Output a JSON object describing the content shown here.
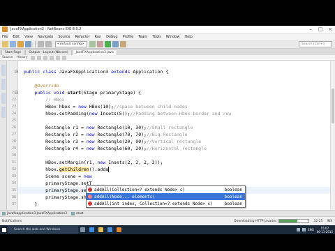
{
  "window": {
    "title": "JavaFXApplication3 - NetBeans IDE 8.0.2",
    "controls": [
      "–",
      "□",
      "×"
    ]
  },
  "menu": [
    "File",
    "Edit",
    "View",
    "Navigate",
    "Source",
    "Refactor",
    "Run",
    "Debug",
    "Profile",
    "Team",
    "Tools",
    "Window",
    "Help"
  ],
  "toolbar": {
    "config": "<default config>",
    "search_placeholder": "Search (Ctrl+I)"
  },
  "tabs": [
    {
      "label": "Start Page",
      "active": false
    },
    {
      "label": "Output - Layout (Nbcore)",
      "active": false
    },
    {
      "label": "JavaFXApplication3.java",
      "active": true
    }
  ],
  "editor_toolbar": [
    "Source",
    "History"
  ],
  "editor": {
    "highlight_line": 35,
    "lines": [
      {
        "n": "",
        "html": ""
      },
      {
        "n": "",
        "html": "  <span class='kw'>public class</span> JavaFXApplication3 <span class='kw'>extends</span> Application {"
      },
      {
        "n": "",
        "html": ""
      },
      {
        "n": "",
        "html": "      <span class='ann'>@Override</span>"
      },
      {
        "n": "21",
        "html": "      <span class='kw'>public void</span> <b>start</b>(Stage primaryStage) {"
      },
      {
        "n": "22",
        "html": "          <span class='cm'>// HBox</span>"
      },
      {
        "n": "23",
        "html": "          HBox hbox = <span class='kw'>new</span> HBox(10);<span class='cm'>//space between child nodes</span>"
      },
      {
        "n": "24",
        "html": "          hbox.setPadding(<span class='kw'>new</span> Insets(5));<span class='cm'>//Padding between Hbox border and row</span>"
      },
      {
        "n": "25",
        "html": ""
      },
      {
        "n": "26",
        "html": "          Rectangle r1 = <span class='kw'>new</span> Rectangle(10, 30);<span class='cm'>//Small rectangle</span>"
      },
      {
        "n": "27",
        "html": "          Rectangle r2 = <span class='kw'>new</span> Rectangle(70, 70);<span class='cm'>//Big Rectangle</span>"
      },
      {
        "n": "28",
        "html": "          Rectangle r3 = <span class='kw'>new</span> Rectangle(20, 90);<span class='cm'>//Vertical rectangle</span>"
      },
      {
        "n": "29",
        "html": "          Rectangle r4 = <span class='kw'>new</span> Rectangle(60, 20);<span class='cm'>//Horizontal rectangle</span>"
      },
      {
        "n": "30",
        "html": ""
      },
      {
        "n": "31",
        "html": "          HBox.setMargin(r1, <span class='kw'>new</span> Insets(2, 2, 2, 2));"
      },
      {
        "n": "32",
        "html": "          hbox.<span class='var-hl'>getChildren</span>().adda<span class='caret'></span>"
      },
      {
        "n": "33",
        "html": "          Scene scene = <span class='kw'>new</span> "
      },
      {
        "n": "34",
        "html": "          primaryStage.setT"
      },
      {
        "n": "35",
        "html": "          primaryStage.setScene(scene);"
      },
      {
        "n": "36",
        "html": "          primaryStage.show();"
      },
      {
        "n": "37",
        "html": "      }"
      }
    ]
  },
  "completion": [
    {
      "name": "addAll(Collection<? extends Node> c)",
      "ret": "boolean",
      "selected": false
    },
    {
      "name": "addAll(Node... elements)",
      "ret": "boolean",
      "selected": true
    },
    {
      "name": "addAll(int index, Collection<? extends Node> c)",
      "ret": "boolean",
      "selected": false
    }
  ],
  "bottom_tabs": [
    "javafxapplication3.JavaFXApplication3",
    "start"
  ],
  "status": {
    "left": "Notifications",
    "task": "Downloading HTTP Javadoc",
    "progress": 0.6,
    "position": "32:25",
    "mode": "INS"
  },
  "taskbar": {
    "search": "Search the web and Windows",
    "lang": "ENG",
    "time": "15:07",
    "date": "06-11-2015"
  }
}
